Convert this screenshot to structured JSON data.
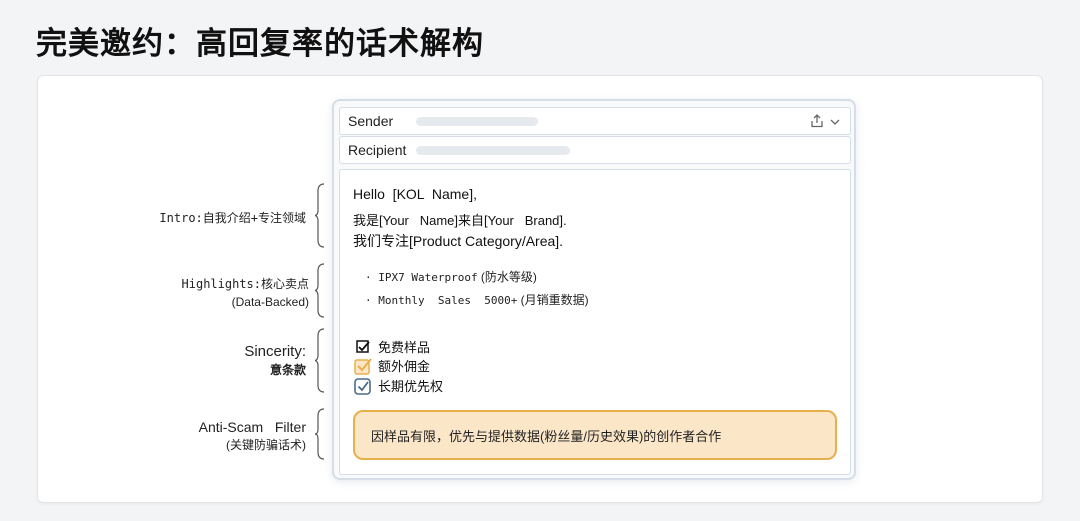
{
  "title": "完美邀约：高回复率的话术解构",
  "annotations": {
    "intro": {
      "text": "Intro:自我介绍+专注领域"
    },
    "highlights": {
      "line1": "Highlights:核心卖点",
      "line2": "(Data-Backed)"
    },
    "sincerity": {
      "line1": "Sincerity:",
      "line2": "意条款"
    },
    "anti_scam": {
      "line1": "Anti-Scam   Filter",
      "line2": "(关键防骗话术)"
    }
  },
  "email": {
    "sender_label": "Sender",
    "recipient_label": "Recipient",
    "greeting": "Hello  [KOL  Name],",
    "intro_line1": "我是[Your   Name]来自[Your   Brand].",
    "intro_line2": "我们专注[Product Category/Area].",
    "bullets": [
      {
        "en": "· IPX7 Waterproof",
        "zh": " (防水等级)"
      },
      {
        "en": "· Monthly  Sales  5000+",
        "zh": " (月销重数据)"
      }
    ],
    "checklist": [
      {
        "label": "免费样品",
        "state": "checked-plain",
        "color": "#111111"
      },
      {
        "label": "额外佣金",
        "state": "checked-accent",
        "color": "#e8b04c"
      },
      {
        "label": "长期优先权",
        "state": "checked-outline",
        "color": "#4a6a8a"
      }
    ],
    "note": "因样品有限，优先与提供数据(粉丝量/历史效果)的创作者合作"
  },
  "colors": {
    "accent_orange": "#e8b04c",
    "note_fill": "#fbe6c8",
    "frame_border": "#d6dde6"
  },
  "icons": [
    "share-icon",
    "chevron-down-icon",
    "checkbox-icon"
  ]
}
